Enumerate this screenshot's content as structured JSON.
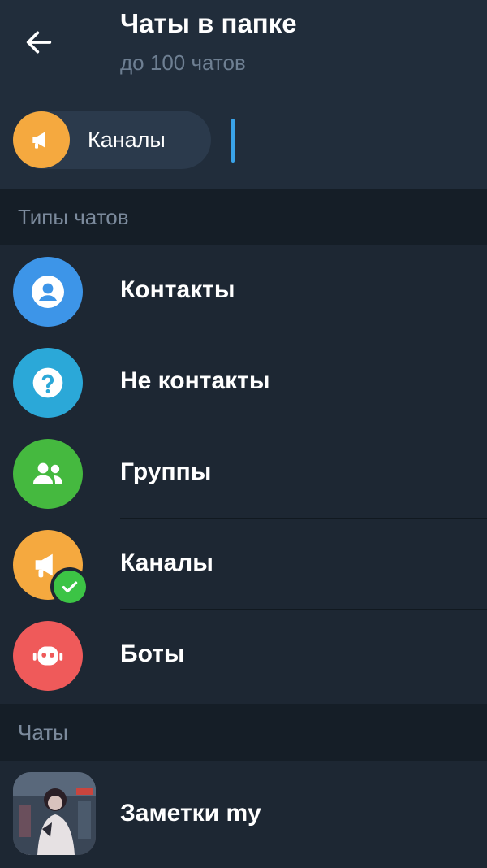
{
  "header": {
    "title": "Чаты в папке",
    "subtitle": "до 100 чатов"
  },
  "chips": [
    {
      "label": "Каналы",
      "icon": "megaphone-icon",
      "color": "#f5a93f"
    }
  ],
  "sections": {
    "chat_types": "Типы чатов",
    "chats": "Чаты"
  },
  "chat_types": [
    {
      "label": "Контакты",
      "icon": "contact-icon",
      "color": "#3d95e8",
      "selected": false
    },
    {
      "label": "Не контакты",
      "icon": "question-icon",
      "color": "#2ba8d8",
      "selected": false
    },
    {
      "label": "Группы",
      "icon": "group-icon",
      "color": "#45b93f",
      "selected": false
    },
    {
      "label": "Каналы",
      "icon": "megaphone-icon",
      "color": "#f5a93f",
      "selected": true
    },
    {
      "label": "Боты",
      "icon": "bot-icon",
      "color": "#ef5a5a",
      "selected": false
    }
  ],
  "chats": [
    {
      "label": "Заметки my",
      "icon": "photo-avatar"
    }
  ],
  "colors": {
    "background": "#1d2733",
    "header": "#212d3b",
    "section": "#151e27",
    "accent": "#3aa3e8",
    "check": "#3cc445"
  }
}
